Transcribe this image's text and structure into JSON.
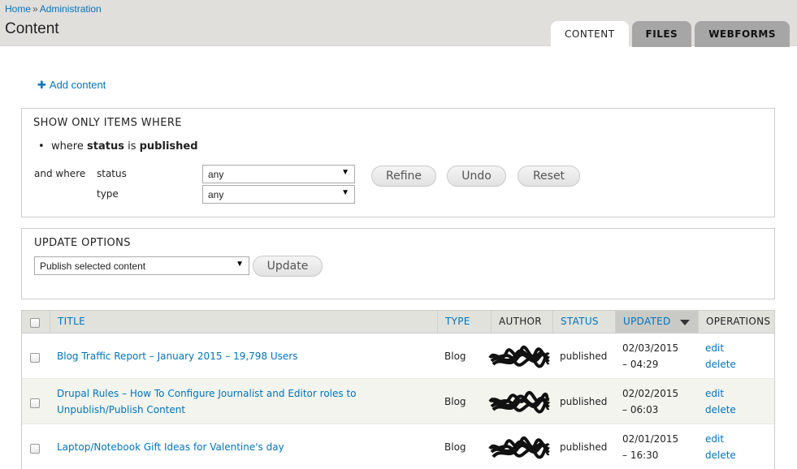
{
  "breadcrumb": {
    "home": "Home",
    "separator": "»",
    "admin": "Administration"
  },
  "page_title": "Content",
  "tabs": [
    {
      "label": "CONTENT",
      "active": true
    },
    {
      "label": "FILES",
      "active": false
    },
    {
      "label": "WEBFORMS",
      "active": false
    }
  ],
  "add_content": {
    "icon": "plus-icon",
    "label": "Add content"
  },
  "filters": {
    "legend": "SHOW ONLY ITEMS WHERE",
    "current": {
      "prefix": "where",
      "field": "status",
      "verb": "is",
      "value": "published"
    },
    "and_where": "and where",
    "status_label": "status",
    "status_value": "any",
    "type_label": "type",
    "type_value": "any",
    "refine": "Refine",
    "undo": "Undo",
    "reset": "Reset"
  },
  "update": {
    "legend": "UPDATE OPTIONS",
    "selected": "Publish selected content",
    "button": "Update"
  },
  "table": {
    "headers": {
      "title": "TITLE",
      "type": "TYPE",
      "author": "AUTHOR",
      "status": "STATUS",
      "updated": "UPDATED",
      "operations": "OPERATIONS"
    },
    "rows": [
      {
        "title": "Blog Traffic Report – January 2015 – 19,798 Users",
        "type": "Blog",
        "status": "published",
        "date": "02/03/2015",
        "time": "– 04:29",
        "edit": "edit",
        "delete": "delete"
      },
      {
        "title": "Drupal Rules – How To Configure Journalist and Editor roles to Unpublish/Publish Content",
        "type": "Blog",
        "status": "published",
        "date": "02/02/2015",
        "time": "– 06:03",
        "edit": "edit",
        "delete": "delete"
      },
      {
        "title": "Laptop/Notebook Gift Ideas for Valentine's day",
        "type": "Blog",
        "status": "published",
        "date": "02/01/2015",
        "time": "– 16:30",
        "edit": "edit",
        "delete": "delete"
      }
    ]
  },
  "colors": {
    "link": "#0074bd",
    "header_bg": "#e0dfdc",
    "table_head_bg": "#e1e2dc"
  }
}
